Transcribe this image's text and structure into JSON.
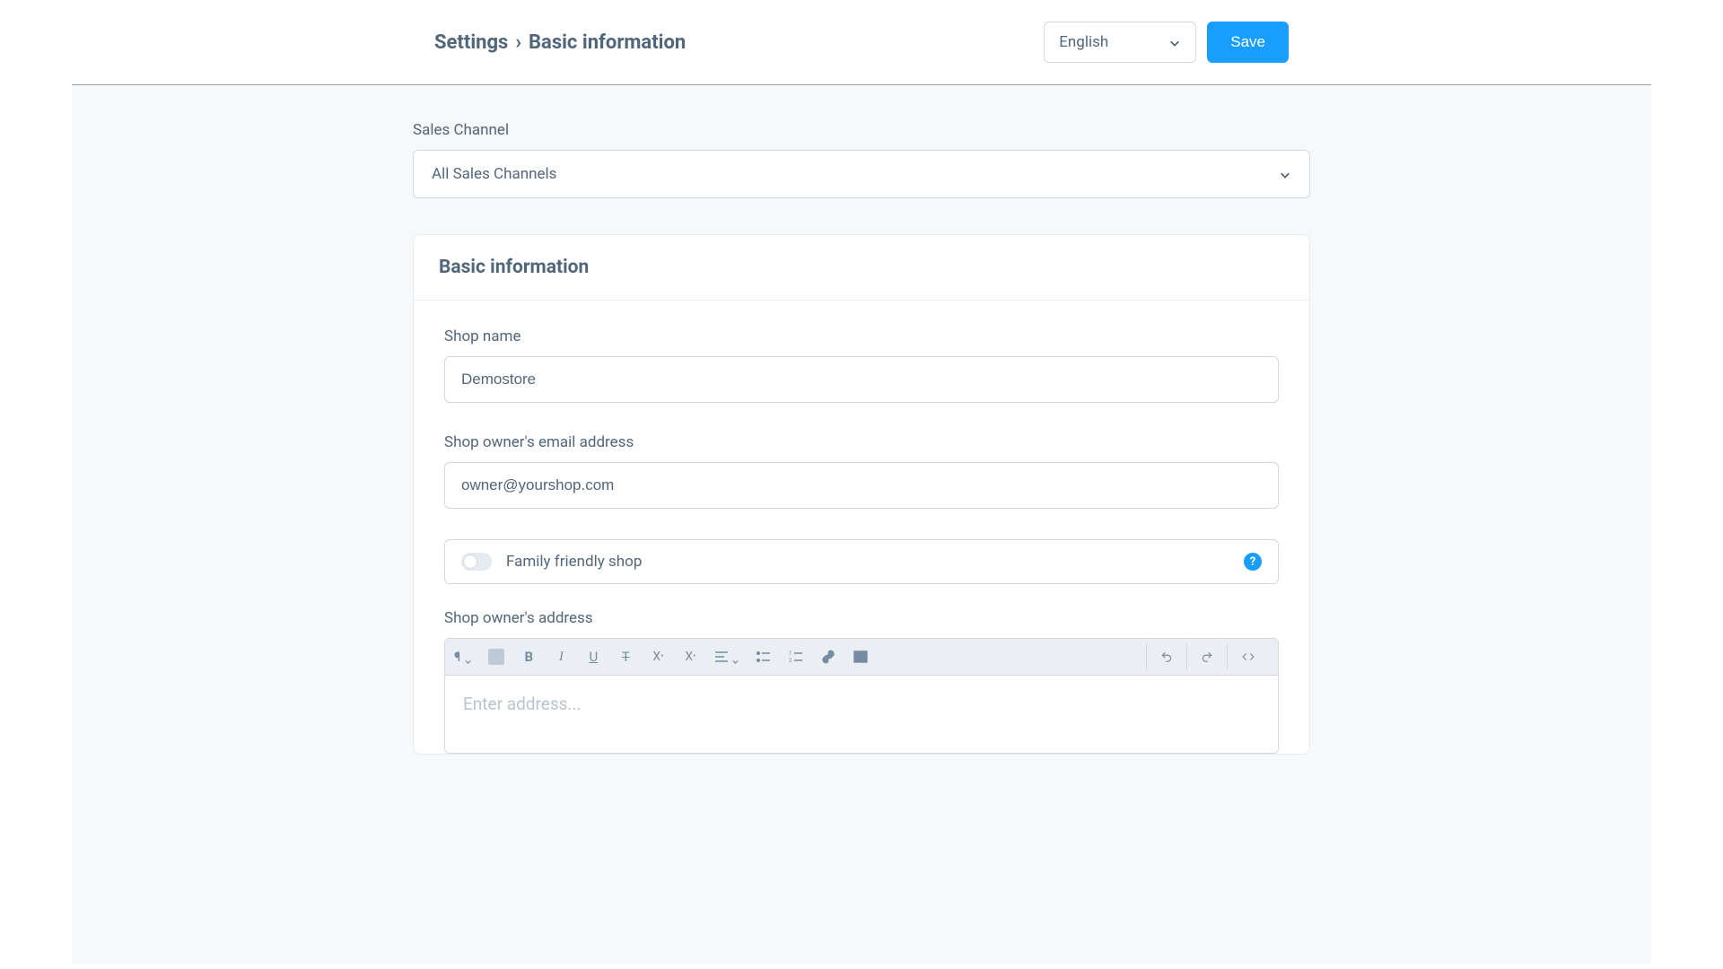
{
  "breadcrumb": {
    "parent": "Settings",
    "separator": "›",
    "current": "Basic information"
  },
  "header": {
    "language": "English",
    "save_label": "Save"
  },
  "salesChannel": {
    "label": "Sales Channel",
    "value": "All Sales Channels"
  },
  "card": {
    "title": "Basic information",
    "shopName": {
      "label": "Shop name",
      "value": "Demostore"
    },
    "ownerEmail": {
      "label": "Shop owner's email address",
      "value": "owner@yourshop.com"
    },
    "familyFriendly": {
      "label": "Family friendly shop",
      "help": "?"
    },
    "ownerAddress": {
      "label": "Shop owner's address",
      "placeholder": "Enter address..."
    }
  },
  "editorToolbar": {
    "pilcrow": "¶",
    "bold": "B",
    "italic": "I",
    "underline": "U",
    "strike": "T",
    "superscript_label": "X",
    "subscript_label": "X",
    "code": "</>"
  }
}
